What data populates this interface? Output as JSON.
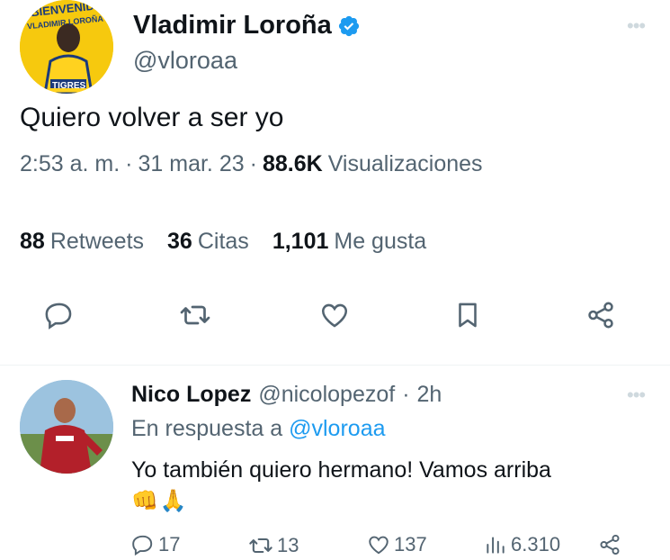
{
  "tweet": {
    "author_name": "Vladimir Loroña",
    "author_handle": "@vloroaa",
    "verified_icon": "verified-badge-icon",
    "text": "Quiero volver a ser yo",
    "time": "2:53 a. m.",
    "sep1": "·",
    "date": "31 mar. 23",
    "sep2": "·",
    "views_count": "88.6K",
    "views_label": "Visualizaciones",
    "avatar_text_line1": "BIENVENIDO",
    "avatar_text_line2": "VLADIMIR LOROÑA",
    "avatar_text_line3": "TIGRES",
    "stats": [
      {
        "count": "88",
        "label": "Retweets"
      },
      {
        "count": "36",
        "label": "Citas"
      },
      {
        "count": "1,101",
        "label": "Me gusta"
      }
    ],
    "actions": [
      "reply-icon",
      "retweet-icon",
      "like-icon",
      "bookmark-icon",
      "share-icon"
    ]
  },
  "reply": {
    "author_name": "Nico Lopez",
    "author_handle": "@nicolopezof",
    "sep": "·",
    "age": "2h",
    "reply_prefix": "En respuesta a",
    "reply_to": "@vloroaa",
    "text": "Yo también quiero hermano! Vamos arriba",
    "emoji1": "👊",
    "emoji2": "🙏",
    "replies": "17",
    "retweets": "13",
    "likes": "137",
    "views": "6.310"
  },
  "colors": {
    "accent": "#1d9bf0",
    "muted": "#536471",
    "text": "#0f1419"
  }
}
